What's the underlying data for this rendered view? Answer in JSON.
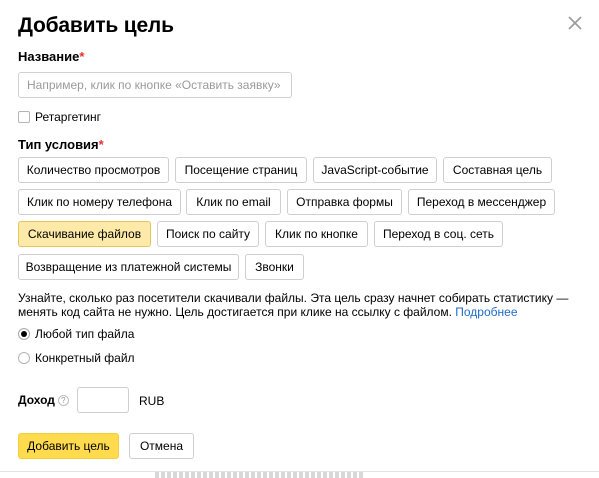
{
  "dialog": {
    "title": "Добавить цель",
    "close_icon": "close-icon"
  },
  "name_field": {
    "label": "Название",
    "required_mark": "*",
    "placeholder": "Например, клик по кнопке «Оставить заявку»",
    "value": ""
  },
  "retargeting": {
    "label": "Ретаргетинг",
    "checked": false
  },
  "condition": {
    "label": "Тип условия",
    "required_mark": "*",
    "types": [
      {
        "label": "Количество просмотров",
        "selected": false
      },
      {
        "label": "Посещение страниц",
        "selected": false
      },
      {
        "label": "JavaScript-событие",
        "selected": false
      },
      {
        "label": "Составная цель",
        "selected": false
      },
      {
        "label": "Клик по номеру телефона",
        "selected": false
      },
      {
        "label": "Клик по email",
        "selected": false
      },
      {
        "label": "Отправка формы",
        "selected": false
      },
      {
        "label": "Переход в мессенджер",
        "selected": false
      },
      {
        "label": "Скачивание файлов",
        "selected": true
      },
      {
        "label": "Поиск по сайту",
        "selected": false
      },
      {
        "label": "Клик по кнопке",
        "selected": false
      },
      {
        "label": "Переход в соц. сеть",
        "selected": false
      },
      {
        "label": "Возвращение из платежной системы",
        "selected": false
      },
      {
        "label": "Звонки",
        "selected": false
      }
    ],
    "selected_color": "#fdeaa8"
  },
  "hint": {
    "text": "Узнайте, сколько раз посетители скачивали файлы. Эта цель сразу начнет собирать статистику — менять код сайта не нужно. Цель достигается при клике на ссылку с файлом.",
    "link": "Подробнее",
    "link_color": "#1f6bc4"
  },
  "file_type": {
    "options": [
      {
        "label": "Любой тип файла",
        "checked": true
      },
      {
        "label": "Конкретный файл",
        "checked": false
      }
    ]
  },
  "income": {
    "label": "Доход",
    "help_icon": "question-icon",
    "help_glyph": "?",
    "value": "",
    "currency": "RUB"
  },
  "actions": {
    "submit_label": "Добавить цель",
    "cancel_label": "Отмена",
    "submit_color": "#ffdb4d"
  }
}
